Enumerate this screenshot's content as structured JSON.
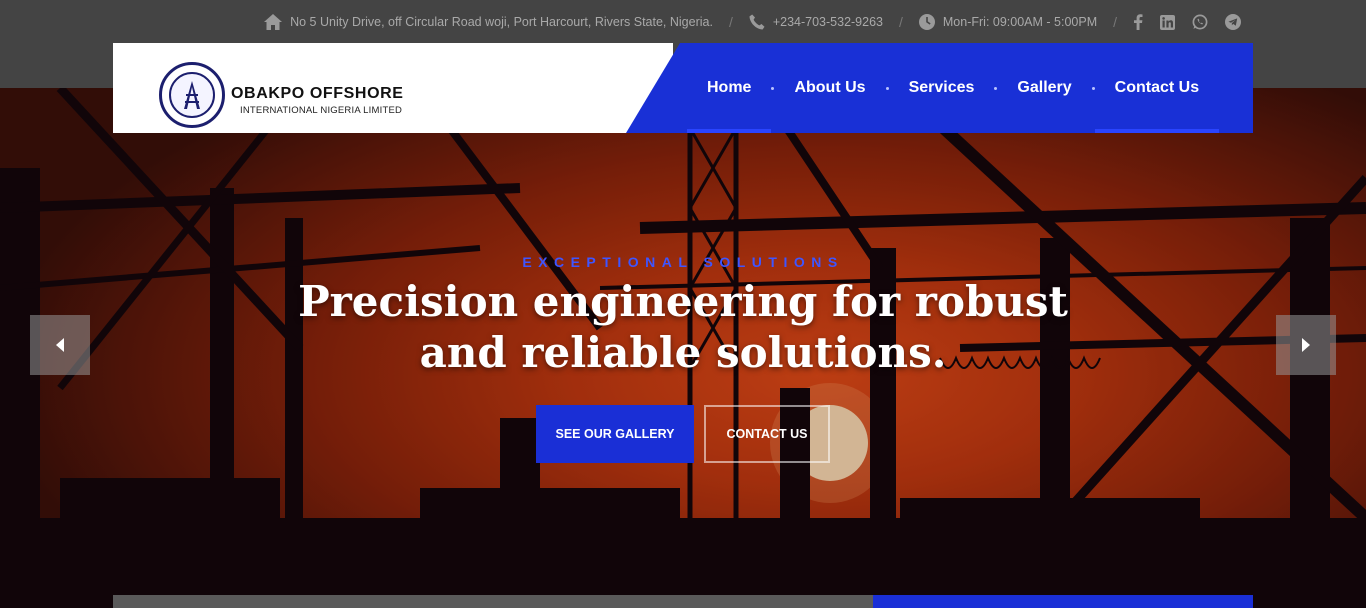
{
  "topbar": {
    "address": "No 5 Unity Drive, off Circular Road woji, Port Harcourt, Rivers State, Nigeria.",
    "phone": "+234-703-532-9263",
    "hours": "Mon-Fri: 09:00AM - 5:00PM",
    "separator": "/",
    "icons": [
      "home-icon",
      "phone-icon",
      "clock-icon"
    ],
    "social": [
      "facebook-icon",
      "linkedin-icon",
      "whatsapp-icon",
      "telegram-icon"
    ]
  },
  "brand": {
    "name": "OBAKPO OFFSHORE",
    "subtitle": "INTERNATIONAL NIGERIA LIMITED"
  },
  "nav": {
    "items": [
      {
        "label": "Home",
        "active": true
      },
      {
        "label": "About Us",
        "active": false
      },
      {
        "label": "Services",
        "active": false
      },
      {
        "label": "Gallery",
        "active": false
      },
      {
        "label": "Contact Us",
        "active": true
      }
    ]
  },
  "hero": {
    "eyebrow": "EXCEPTIONAL SOLUTIONS",
    "headline_line1": "Precision engineering for robust",
    "headline_line2": "and reliable solutions.",
    "primary_button": "SEE OUR GALLERY",
    "secondary_button": "CONTACT US"
  },
  "colors": {
    "accent": "#1a2fd6",
    "topbar": "#444444"
  }
}
